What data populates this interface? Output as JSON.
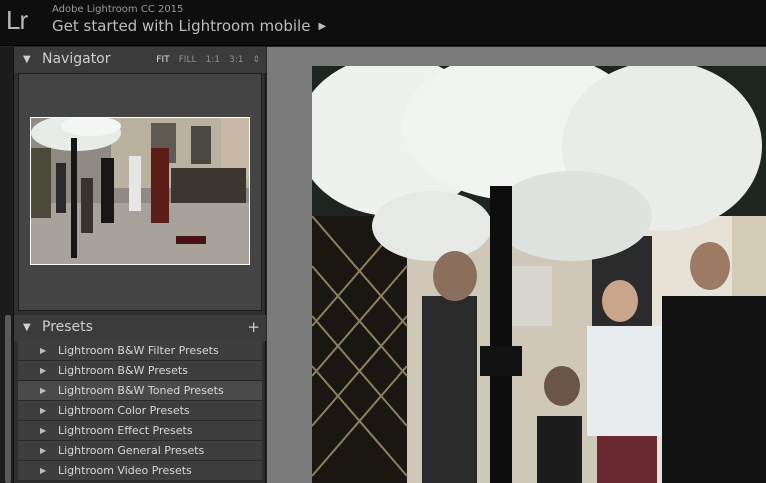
{
  "app": {
    "logo": "Lr",
    "title": "Adobe Lightroom CC 2015",
    "subtitle": "Get started with Lightroom mobile",
    "subtitle_arrow": "▶"
  },
  "navigator": {
    "collapse_icon": "▼",
    "title": "Navigator",
    "options": [
      "FIT",
      "FILL",
      "1:1",
      "3:1"
    ],
    "options_arrow": "⇕",
    "active_option": "FIT"
  },
  "presets": {
    "collapse_icon": "▼",
    "title": "Presets",
    "add_icon": "+",
    "items": [
      "Lightroom B&W Filter Presets",
      "Lightroom B&W Presets",
      "Lightroom B&W Toned Presets",
      "Lightroom Color Presets",
      "Lightroom Effect Presets",
      "Lightroom General Presets",
      "Lightroom Video Presets"
    ],
    "selected_index": 2,
    "item_expand_icon": "▶"
  },
  "colors": {
    "topbar": "#0e0e0e",
    "panel": "#2f2f2f",
    "panel_header": "#3b3b3b",
    "canvas": "#7a7a7a"
  }
}
